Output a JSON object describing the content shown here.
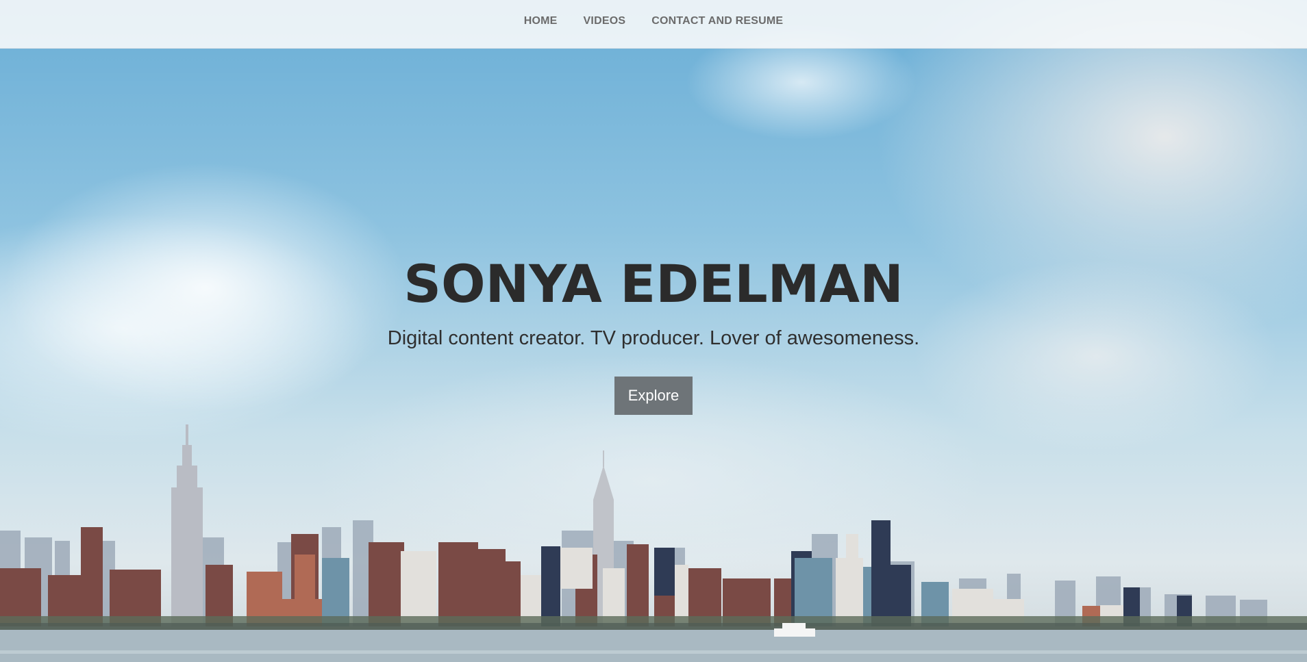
{
  "nav": {
    "items": [
      {
        "label": "HOME"
      },
      {
        "label": "VIDEOS"
      },
      {
        "label": "CONTACT AND RESUME"
      }
    ]
  },
  "hero": {
    "title": "SONYA EDELMAN",
    "subtitle": "Digital content creator. TV producer. Lover of awesomeness.",
    "button_label": "Explore",
    "background": "nyc-skyline-photo"
  },
  "colors": {
    "nav_text": "#6b6b6b",
    "title_text": "#2b2b2b",
    "button_bg": "#6e7478",
    "button_text": "#ffffff"
  }
}
